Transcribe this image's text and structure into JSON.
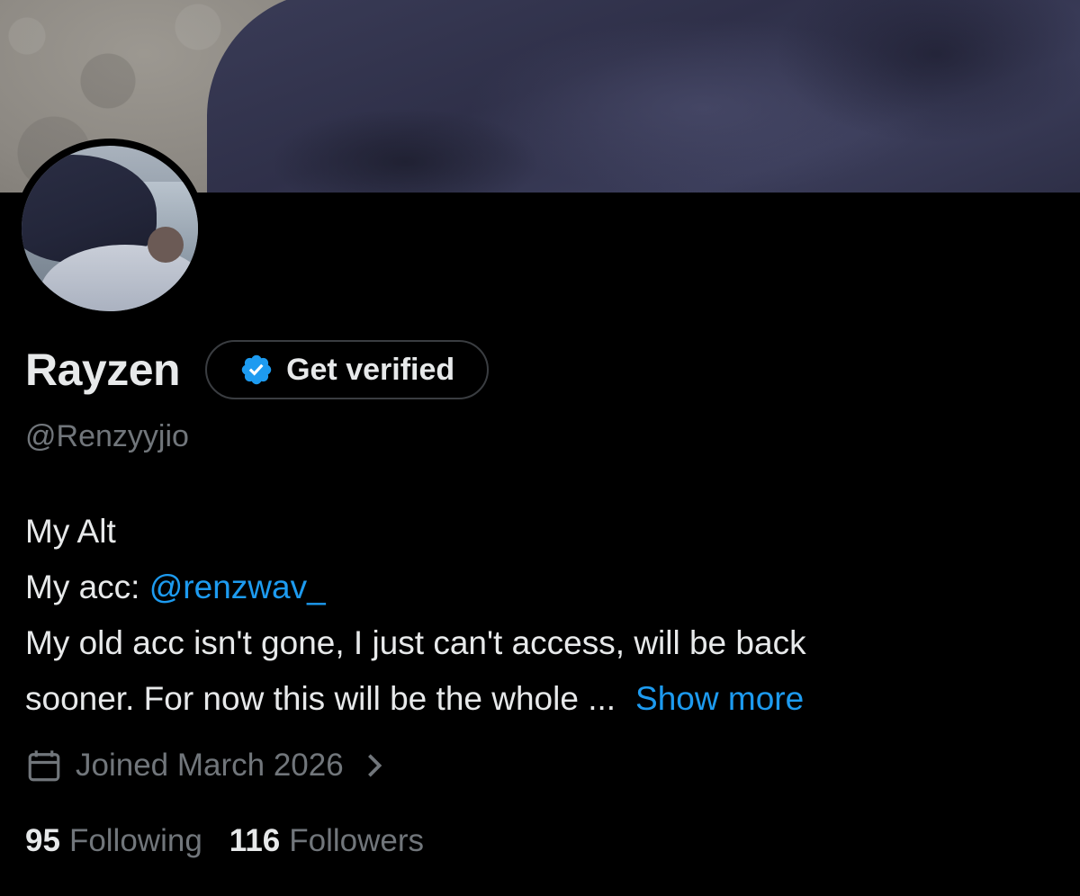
{
  "profile": {
    "display_name": "Rayzen",
    "handle": "@Renzyyjio",
    "verify_label": "Get verified",
    "bio": {
      "line1": "My Alt",
      "line2_prefix": "My acc: ",
      "line2_link": "@renzwav_",
      "line3": "My old acc isn't gone, I just can't access, will be back",
      "line4": "sooner. For now this will be the whole ...",
      "show_more": "Show more"
    },
    "joined": "Joined March 2026",
    "following_count": "95",
    "following_label": "Following",
    "followers_count": "116",
    "followers_label": "Followers"
  },
  "colors": {
    "background": "#000000",
    "text_primary": "#e7e9ea",
    "text_secondary": "#71767b",
    "accent": "#1d9bf0"
  },
  "icons": {
    "verify_badge": "verified-badge-icon",
    "calendar": "calendar-icon",
    "chevron": "chevron-right-icon"
  }
}
